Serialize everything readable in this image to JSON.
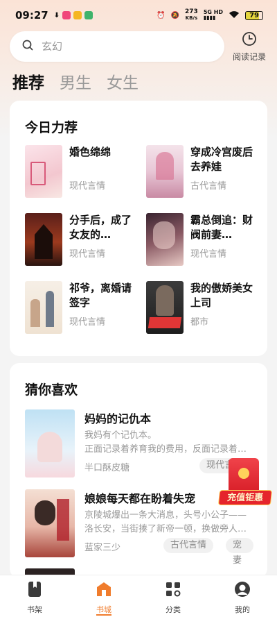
{
  "status": {
    "time": "09:27",
    "net_speed": "273",
    "net_unit": "KB/s",
    "signal": "5G HD",
    "battery": "79"
  },
  "search": {
    "placeholder": "玄幻",
    "history_label": "阅读记录"
  },
  "categories": [
    "推荐",
    "男生",
    "女生"
  ],
  "recommend": {
    "title": "今日力荐",
    "books": [
      {
        "title": "婚色绵绵",
        "genre": "现代言情"
      },
      {
        "title": "穿成冷宫废后去养娃",
        "genre": "古代言情"
      },
      {
        "title": "分手后，成了女友的…",
        "genre": "现代言情"
      },
      {
        "title": "霸总倒追：财阀前妻…",
        "genre": "现代言情"
      },
      {
        "title": "祁爷，离婚请签字",
        "genre": "现代言情"
      },
      {
        "title": "我的傲娇美女上司",
        "genre": "都市"
      }
    ]
  },
  "feed": {
    "title": "猜你喜欢",
    "items": [
      {
        "title": "妈妈的记仇本",
        "desc1": "我妈有个记仇本。",
        "desc2": "正面记录着养育我的费用，反面记录着…",
        "author": "半口酥皮糖",
        "tags": [
          "现代言"
        ]
      },
      {
        "title": "娘娘每天都在盼着失宠",
        "desc1": "京陵城爆出一条大消息，头号小公子——",
        "desc2": "洛长安，当街揍了新帝一顿，换做旁人…",
        "author": "蓝家三少",
        "tags": [
          "古代言情",
          "宠妻"
        ]
      }
    ]
  },
  "promo": {
    "label": "充值钜惠"
  },
  "nav": [
    "书架",
    "书城",
    "分类",
    "我的"
  ],
  "colors": {
    "accent": "#f07c2c"
  }
}
